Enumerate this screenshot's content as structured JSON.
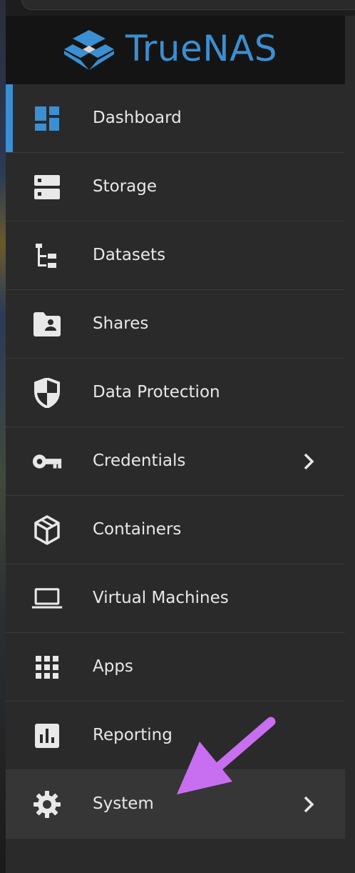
{
  "brand": {
    "name": "TrueNAS",
    "accent": "#3b8fd2"
  },
  "sidebar": {
    "items": [
      {
        "label": "Dashboard",
        "icon": "dashboard-icon"
      },
      {
        "label": "Storage",
        "icon": "storage-icon"
      },
      {
        "label": "Datasets",
        "icon": "datasets-icon"
      },
      {
        "label": "Shares",
        "icon": "shares-folder-icon"
      },
      {
        "label": "Data Protection",
        "icon": "shield-icon"
      },
      {
        "label": "Credentials",
        "icon": "key-icon",
        "has_submenu": true
      },
      {
        "label": "Containers",
        "icon": "cube-icon"
      },
      {
        "label": "Virtual Machines",
        "icon": "laptop-icon"
      },
      {
        "label": "Apps",
        "icon": "apps-grid-icon"
      },
      {
        "label": "Reporting",
        "icon": "bar-chart-icon"
      },
      {
        "label": "System",
        "icon": "gear-icon",
        "has_submenu": true
      }
    ]
  },
  "annotation": {
    "color": "#c86ef0",
    "icon": "arrow-pointer-icon"
  }
}
